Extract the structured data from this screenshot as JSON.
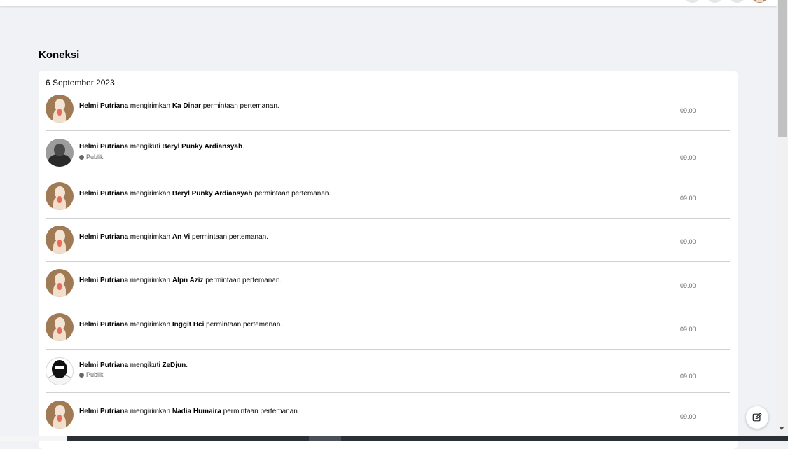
{
  "page_title": "Koneksi",
  "date_label": "6 September 2023",
  "actor": "Helmi Putriana",
  "rows": [
    {
      "actor": "Helmi Putriana",
      "verb": " mengirimkan ",
      "target": "Ka Dinar",
      "suffix": " permintaan pertemanan.",
      "privacy": "",
      "time": "09.00"
    },
    {
      "actor": "Helmi Putriana",
      "verb": " mengikuti ",
      "target": "Beryl Punky Ardiansyah",
      "suffix": ".",
      "privacy": "Publik",
      "time": "09.00"
    },
    {
      "actor": "Helmi Putriana",
      "verb": " mengirimkan ",
      "target": "Beryl Punky Ardiansyah",
      "suffix": " permintaan pertemanan.",
      "privacy": "",
      "time": "09.00"
    },
    {
      "actor": "Helmi Putriana",
      "verb": " mengirimkan ",
      "target": "An Vi",
      "suffix": " permintaan pertemanan.",
      "privacy": "",
      "time": "09.00"
    },
    {
      "actor": "Helmi Putriana",
      "verb": " mengirimkan ",
      "target": "Alpn Aziz",
      "suffix": " permintaan pertemanan.",
      "privacy": "",
      "time": "09.00"
    },
    {
      "actor": "Helmi Putriana",
      "verb": " mengirimkan ",
      "target": "Inggit Hci",
      "suffix": " permintaan pertemanan.",
      "privacy": "",
      "time": "09.00"
    },
    {
      "actor": "Helmi Putriana",
      "verb": " mengikuti ",
      "target": "ZeDjun",
      "suffix": ".",
      "privacy": "Publik",
      "time": "09.00"
    },
    {
      "actor": "Helmi Putriana",
      "verb": " mengirimkan ",
      "target": "Nadia Humaira",
      "suffix": " permintaan pertemanan.",
      "privacy": "",
      "time": "09.00"
    }
  ],
  "colors": {
    "background": "#f0f2f5",
    "card": "#ffffff",
    "text": "#050505",
    "muted": "#65676b",
    "divider": "#cfd1d5"
  },
  "icons": {
    "compose": "compose-edit-icon",
    "privacy": "globe-icon",
    "scroll": "scroll-down-arrow-icon"
  }
}
